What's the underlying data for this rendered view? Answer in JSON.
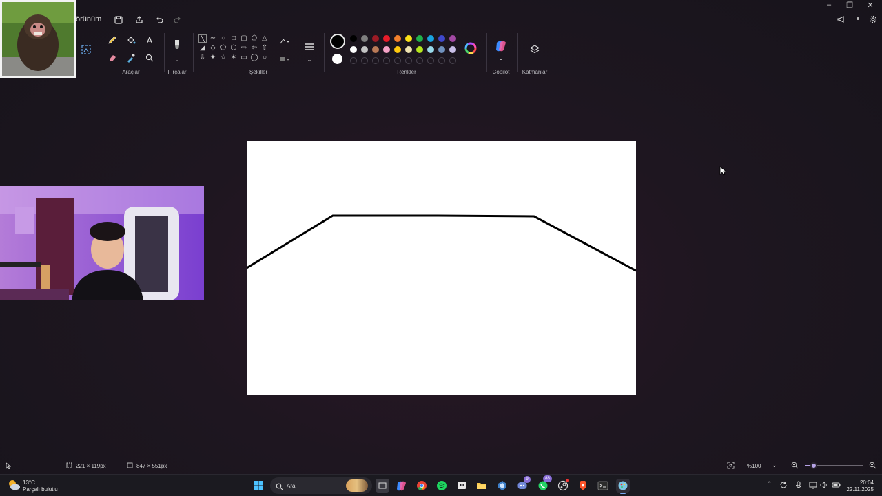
{
  "titlebar": {
    "menu_label": "örünüm",
    "icons": [
      "save-icon",
      "share-icon",
      "undo-icon",
      "redo-icon"
    ],
    "right_icons": [
      "announce-icon",
      "profile-icon",
      "settings-icon"
    ]
  },
  "ribbon": {
    "groups": {
      "tools": "Araçlar",
      "brushes": "Fırçalar",
      "shapes": "Şekiller",
      "colors": "Renkler",
      "copilot": "Copilot",
      "layers": "Katmanlar"
    },
    "palette_row1": [
      "#000000",
      "#7f7f7f",
      "#9c1b25",
      "#e81c2a",
      "#f3802c",
      "#fbe217",
      "#20b24b",
      "#19a3e0",
      "#3f48cc",
      "#a349a4"
    ],
    "palette_row2": [
      "#ffffff",
      "#c3c3c3",
      "#b97a57",
      "#f5a3c7",
      "#ffc90e",
      "#efe4b0",
      "#b5e61d",
      "#99d9ea",
      "#7092be",
      "#c8bfe7"
    ],
    "primary_color": "#000000",
    "secondary_color": "#ffffff"
  },
  "statusbar": {
    "selection_size": "221 × 119px",
    "canvas_size": "847 × 551px",
    "zoom": "%100"
  },
  "taskbar": {
    "weather_temp": "13°C",
    "weather_desc": "Parçalı bulutlu",
    "search_placeholder": "Ara",
    "time": "20:04",
    "date": "22.11.2025",
    "badge_discord": "9",
    "badge_whatsapp": "88"
  }
}
